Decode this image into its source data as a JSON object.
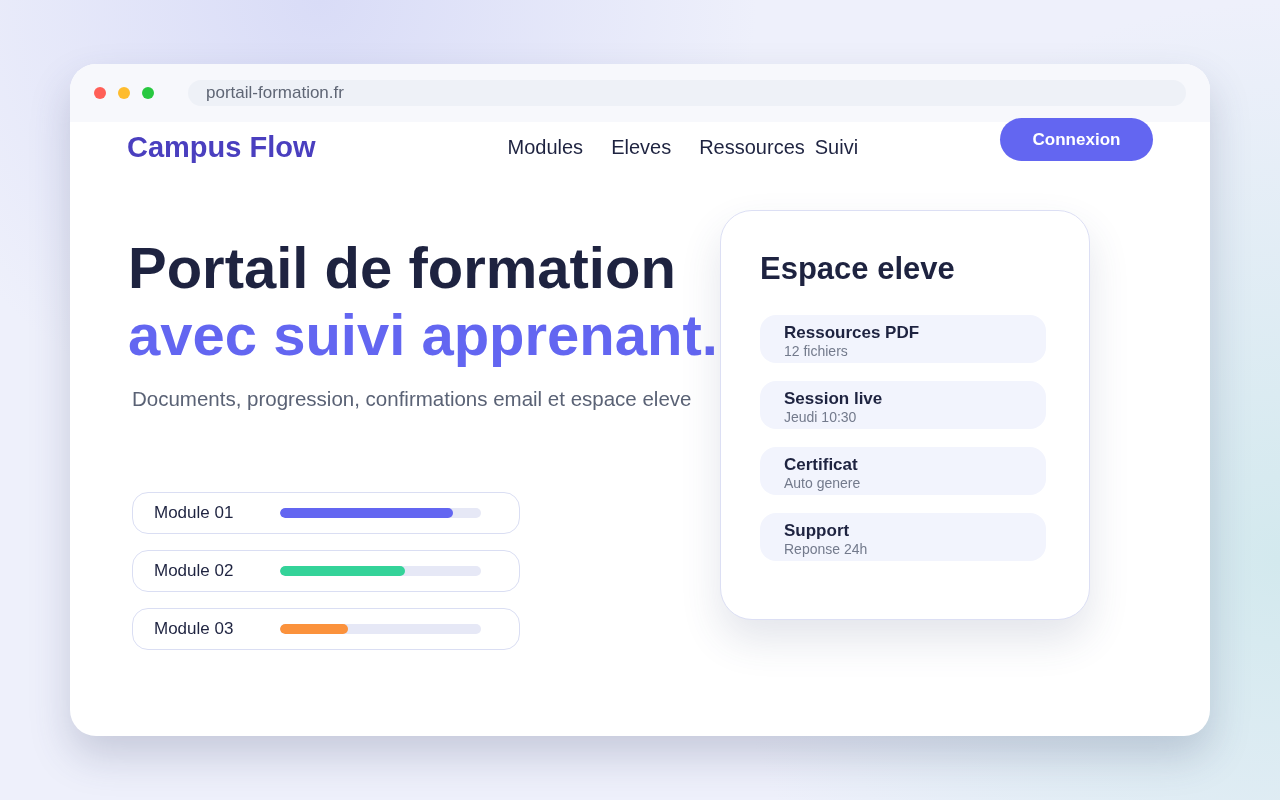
{
  "browser": {
    "url": "portail-formation.fr"
  },
  "nav": {
    "logo": "Campus Flow",
    "links": [
      "Modules",
      "Eleves",
      "Ressources",
      "Suivi"
    ],
    "button": "Connexion"
  },
  "hero": {
    "title": "Portail de formation",
    "title_accent": "avec suivi apprenant.",
    "subtitle": "Documents, progression, confirmations email et espace eleve"
  },
  "modules": [
    {
      "label": "Module 01",
      "level": 0.86,
      "color": "#6366f1"
    },
    {
      "label": "Module 02",
      "level": 0.62,
      "color": "#34d399"
    },
    {
      "label": "Module 03",
      "level": 0.34,
      "color": "#fb923c"
    }
  ],
  "card": {
    "title": "Espace eleve",
    "items": [
      {
        "title": "Ressources PDF",
        "subtitle": "12 fichiers"
      },
      {
        "title": "Session live",
        "subtitle": "Jeudi 10:30"
      },
      {
        "title": "Certificat",
        "subtitle": "Auto genere"
      },
      {
        "title": "Support",
        "subtitle": "Reponse 24h"
      }
    ]
  }
}
